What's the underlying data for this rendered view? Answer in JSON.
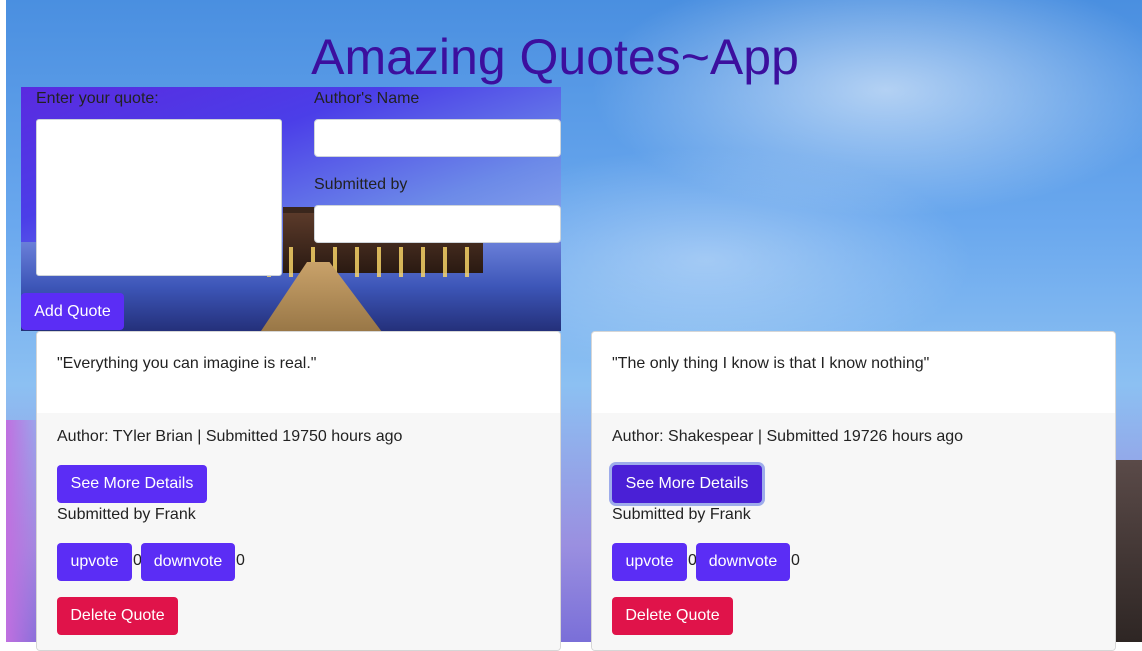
{
  "app_title": "Amazing Quotes~App",
  "form": {
    "quote_label": "Enter your quote:",
    "author_label": "Author's Name",
    "submitted_label": "Submitted by",
    "add_button": "Add Quote"
  },
  "quotes": [
    {
      "text": "\"Everything you can imagine is real.\"",
      "meta": "Author: TYler Brian | Submitted 19750 hours ago",
      "details_button": "See More Details",
      "submitted_by": "Submitted by Frank",
      "upvote_label": "upvote",
      "upvotes": "0",
      "downvote_label": "downvote",
      "downvotes": "0",
      "delete_button": "Delete Quote"
    },
    {
      "text": "\"The only thing I know is that I know nothing\"",
      "meta": "Author: Shakespear | Submitted 19726 hours ago",
      "details_button": "See More Details",
      "submitted_by": "Submitted by Frank",
      "upvote_label": "upvote",
      "upvotes": "0",
      "downvote_label": "downvote",
      "downvotes": "0",
      "delete_button": "Delete Quote"
    }
  ],
  "colors": {
    "title": "#3c0f9e",
    "primary_button": "#5b2df5",
    "danger_button": "#e0134a"
  }
}
